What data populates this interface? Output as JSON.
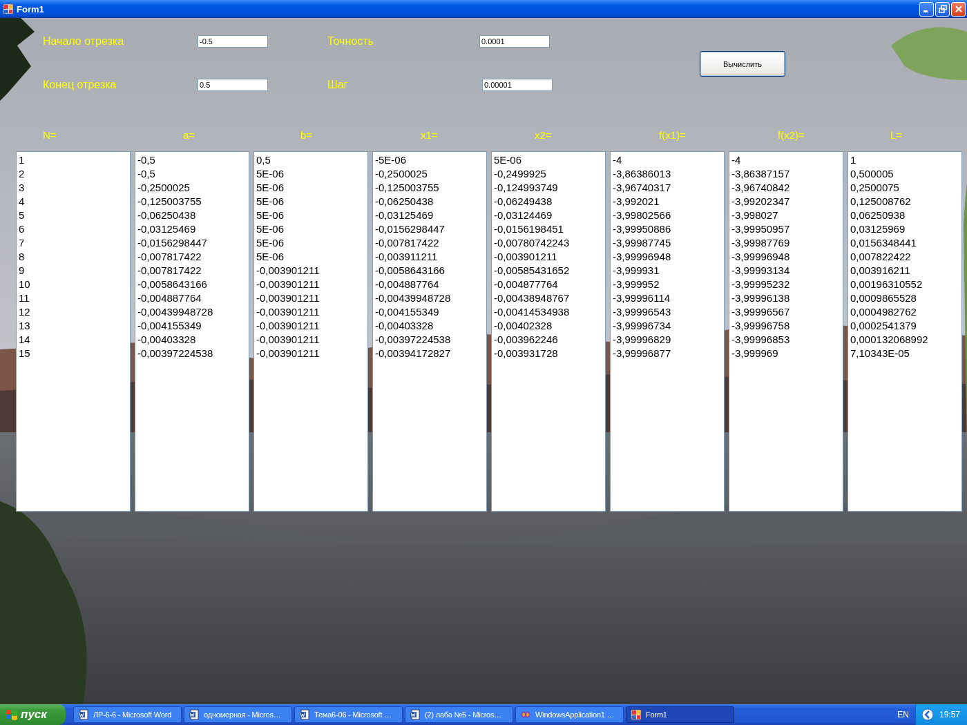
{
  "window": {
    "title": "Form1"
  },
  "fields": [
    {
      "label": "Начало отрезка",
      "value": "-0.5"
    },
    {
      "label": "Конец отрезка",
      "value": "0.5"
    },
    {
      "label": "Точность",
      "value": "0.0001"
    },
    {
      "label": "Шаг",
      "value": "0.00001"
    }
  ],
  "button": "Вычислить",
  "columns": [
    {
      "header": "N=",
      "values": [
        "1",
        "2",
        "3",
        "4",
        "5",
        "6",
        "7",
        "8",
        "9",
        "10",
        "11",
        "12",
        "13",
        "14",
        "15"
      ]
    },
    {
      "header": "a=",
      "values": [
        "-0,5",
        "-0,5",
        "-0,2500025",
        "-0,125003755",
        "-0,06250438",
        "-0,03125469",
        "-0,0156298447",
        "-0,007817422",
        "-0,007817422",
        "-0,0058643166",
        "-0,004887764",
        "-0,00439948728",
        "-0,004155349",
        "-0,00403328",
        "-0,00397224538"
      ]
    },
    {
      "header": "b=",
      "values": [
        "0,5",
        "5E-06",
        "5E-06",
        "5E-06",
        "5E-06",
        "5E-06",
        "5E-06",
        "5E-06",
        "-0,003901211",
        "-0,003901211",
        "-0,003901211",
        "-0,003901211",
        "-0,003901211",
        "-0,003901211",
        "-0,003901211"
      ]
    },
    {
      "header": "x1=",
      "values": [
        "-5E-06",
        "-0,2500025",
        "-0,125003755",
        "-0,06250438",
        "-0,03125469",
        "-0,0156298447",
        "-0,007817422",
        "-0,003911211",
        "-0,0058643166",
        "-0,004887764",
        "-0,00439948728",
        "-0,004155349",
        "-0,00403328",
        "-0,00397224538",
        "-0,00394172827"
      ]
    },
    {
      "header": "x2=",
      "values": [
        "5E-06",
        "-0,2499925",
        "-0,124993749",
        "-0,06249438",
        "-0,03124469",
        "-0,0156198451",
        "-0,00780742243",
        "-0,003901211",
        "-0,00585431652",
        "-0,004877764",
        "-0,00438948767",
        "-0,00414534938",
        "-0,00402328",
        "-0,003962246",
        "-0,003931728"
      ]
    },
    {
      "header": "f(x1)=",
      "values": [
        "-4",
        "-3,86386013",
        "-3,96740317",
        "-3,992021",
        "-3,99802566",
        "-3,99950886",
        "-3,99987745",
        "-3,99996948",
        "-3,999931",
        "-3,999952",
        "-3,99996114",
        "-3,99996543",
        "-3,99996734",
        "-3,99996829",
        "-3,99996877"
      ]
    },
    {
      "header": "f(x2)=",
      "values": [
        "-4",
        "-3,86387157",
        "-3,96740842",
        "-3,99202347",
        "-3,998027",
        "-3,99950957",
        "-3,99987769",
        "-3,99996948",
        "-3,99993134",
        "-3,99995232",
        "-3,99996138",
        "-3,99996567",
        "-3,99996758",
        "-3,99996853",
        "-3,999969"
      ]
    },
    {
      "header": "L=",
      "values": [
        "1",
        "0,500005",
        "0,2500075",
        "0,125008762",
        "0,06250938",
        "0,03125969",
        "0,0156348441",
        "0,007822422",
        "0,003916211",
        "0,00196310552",
        "0,0009865528",
        "0,0004982762",
        "0,0002541379",
        "0,000132068992",
        "7,10343E-05"
      ]
    }
  ],
  "taskbar": {
    "start": "пуск",
    "items": [
      {
        "label": "ЛР-6-6 - Microsoft Word",
        "kind": "word",
        "selected": false
      },
      {
        "label": "одномерная - Micros…",
        "kind": "word",
        "selected": false
      },
      {
        "label": "Тема6-06 - Microsoft …",
        "kind": "word",
        "selected": false
      },
      {
        "label": "(2) лаба №5 - Micros…",
        "kind": "word",
        "selected": false
      },
      {
        "label": "WindowsApplication1 …",
        "kind": "studio",
        "selected": false
      },
      {
        "label": "Form1",
        "kind": "form",
        "selected": true
      }
    ],
    "language": "EN",
    "clock": "19:57"
  }
}
